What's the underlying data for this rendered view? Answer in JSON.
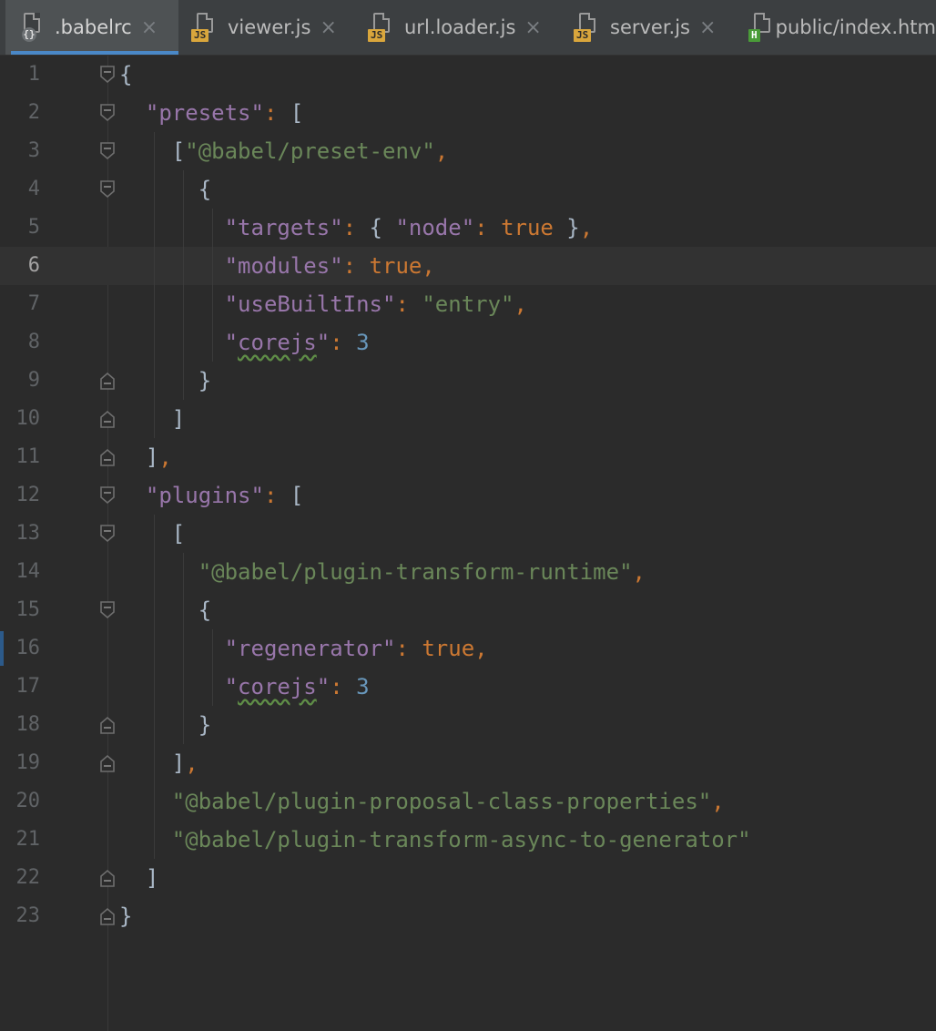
{
  "tabs": [
    {
      "label": ".babelrc",
      "icon": "config-file-icon",
      "badge": "{}",
      "active": true,
      "closable": true
    },
    {
      "label": "viewer.js",
      "icon": "javascript-file-icon",
      "badge": "JS",
      "active": false,
      "closable": true
    },
    {
      "label": "url.loader.js",
      "icon": "javascript-file-icon",
      "badge": "JS",
      "active": false,
      "closable": true
    },
    {
      "label": "server.js",
      "icon": "javascript-file-icon",
      "badge": "JS",
      "active": false,
      "closable": true
    },
    {
      "label": "public/index.htm",
      "icon": "html-file-icon",
      "badge": "H",
      "active": false,
      "closable": false
    }
  ],
  "close_glyph": "×",
  "editor": {
    "language": "json",
    "current_line": 6,
    "lines": [
      {
        "n": "1",
        "text": "{"
      },
      {
        "n": "2",
        "text": "  \"presets\": ["
      },
      {
        "n": "3",
        "text": "    [\"@babel/preset-env\","
      },
      {
        "n": "4",
        "text": "      {"
      },
      {
        "n": "5",
        "text": "        \"targets\": { \"node\": true },"
      },
      {
        "n": "6",
        "text": "        \"modules\": true,"
      },
      {
        "n": "7",
        "text": "        \"useBuiltIns\": \"entry\","
      },
      {
        "n": "8",
        "text": "        \"corejs\": 3"
      },
      {
        "n": "9",
        "text": "      }"
      },
      {
        "n": "10",
        "text": "    ]"
      },
      {
        "n": "11",
        "text": "  ],"
      },
      {
        "n": "12",
        "text": "  \"plugins\": ["
      },
      {
        "n": "13",
        "text": "    ["
      },
      {
        "n": "14",
        "text": "      \"@babel/plugin-transform-runtime\","
      },
      {
        "n": "15",
        "text": "      {"
      },
      {
        "n": "16",
        "text": "        \"regenerator\": true,"
      },
      {
        "n": "17",
        "text": "        \"corejs\": 3"
      },
      {
        "n": "18",
        "text": "      }"
      },
      {
        "n": "19",
        "text": "    ],"
      },
      {
        "n": "20",
        "text": "    \"@babel/plugin-proposal-class-properties\","
      },
      {
        "n": "21",
        "text": "    \"@babel/plugin-transform-async-to-generator\""
      },
      {
        "n": "22",
        "text": "  ]"
      },
      {
        "n": "23",
        "text": "}"
      }
    ],
    "fold_markers": {
      "1": "open",
      "2": "open",
      "3": "open",
      "4": "open",
      "9": "close",
      "10": "close",
      "11": "close",
      "12": "open",
      "13": "open",
      "15": "open",
      "18": "close",
      "19": "close",
      "22": "close",
      "23": "close"
    },
    "spellcheck_words": [
      "corejs"
    ]
  },
  "colors": {
    "background": "#2b2b2b",
    "key": "#9876aa",
    "string": "#6a8759",
    "keyword": "#cc7832",
    "number": "#6897bb",
    "punctuation": "#a9b7c6",
    "active_tab_underline": "#4a88c7"
  }
}
